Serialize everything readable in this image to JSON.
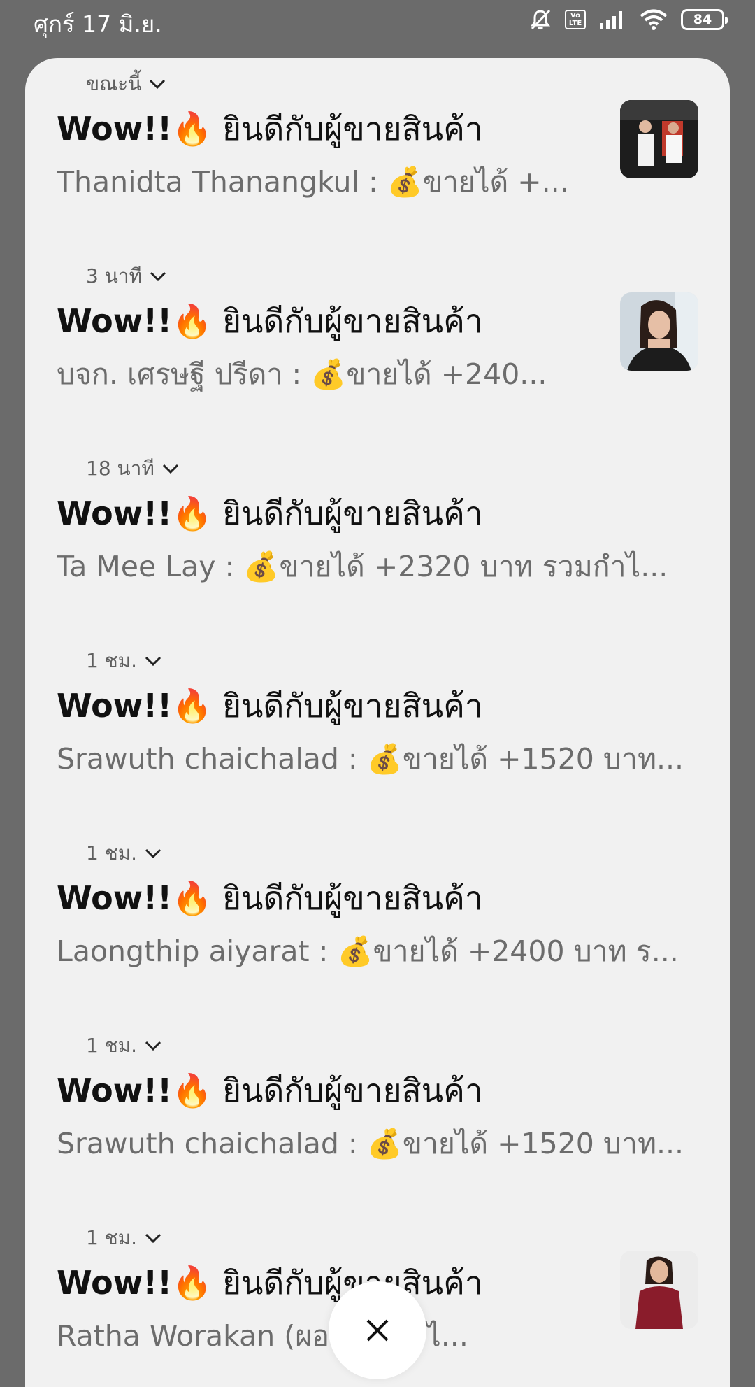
{
  "status_bar": {
    "date": "ศุกร์ 17 มิ.ย.",
    "volte_label": "Vo LTE",
    "battery_level": "84",
    "icons": [
      "mute-icon",
      "volte-icon",
      "signal-icon",
      "wifi-icon",
      "battery-icon"
    ]
  },
  "notifications": [
    {
      "time": "ขณะนี้",
      "wow": "Wow!!",
      "emoji": "🔥",
      "title": "ยินดีกับผู้ขายสินค้า",
      "name": "Thanidta Thanangkul :",
      "money": "💰",
      "body": "ขายได้ +...",
      "thumb": "photo-group"
    },
    {
      "time": "3 นาที",
      "wow": "Wow!!",
      "emoji": "🔥",
      "title": "ยินดีกับผู้ขายสินค้า",
      "name": "บจก. เศรษฐี ปรีดา :",
      "money": "💰",
      "body": "ขายได้ +240...",
      "thumb": "photo-woman"
    },
    {
      "time": "18 นาที",
      "wow": "Wow!!",
      "emoji": "🔥",
      "title": "ยินดีกับผู้ขายสินค้า",
      "name": "Ta Mee Lay :",
      "money": "💰",
      "body": "ขายได้ +2320 บาท รวมกำไ...",
      "thumb": null
    },
    {
      "time": "1 ชม.",
      "wow": "Wow!!",
      "emoji": "🔥",
      "title": "ยินดีกับผู้ขายสินค้า",
      "name": "Srawuth chaichalad :",
      "money": "💰",
      "body": "ขายได้ +1520 บาท...",
      "thumb": null
    },
    {
      "time": "1 ชม.",
      "wow": "Wow!!",
      "emoji": "🔥",
      "title": "ยินดีกับผู้ขายสินค้า",
      "name": "Laongthip aiyarat  :",
      "money": "💰",
      "body": "ขายได้ +2400 บาท ร...",
      "thumb": null
    },
    {
      "time": "1 ชม.",
      "wow": "Wow!!",
      "emoji": "🔥",
      "title": "ยินดีกับผู้ขายสินค้า",
      "name": "Srawuth chaichalad :",
      "money": "💰",
      "body": "ขายได้ +1520 บาท...",
      "thumb": null
    },
    {
      "time": "1 ชม.",
      "wow": "Wow!!",
      "emoji": "🔥",
      "title": "ยินดีกับผู้ขายสินค้า",
      "name": "Ratha Worakan (ผอ",
      "money": "💰",
      "body": "ขายไ...",
      "thumb": "photo-red-dress"
    }
  ],
  "close_button": {
    "icon": "close-icon"
  }
}
